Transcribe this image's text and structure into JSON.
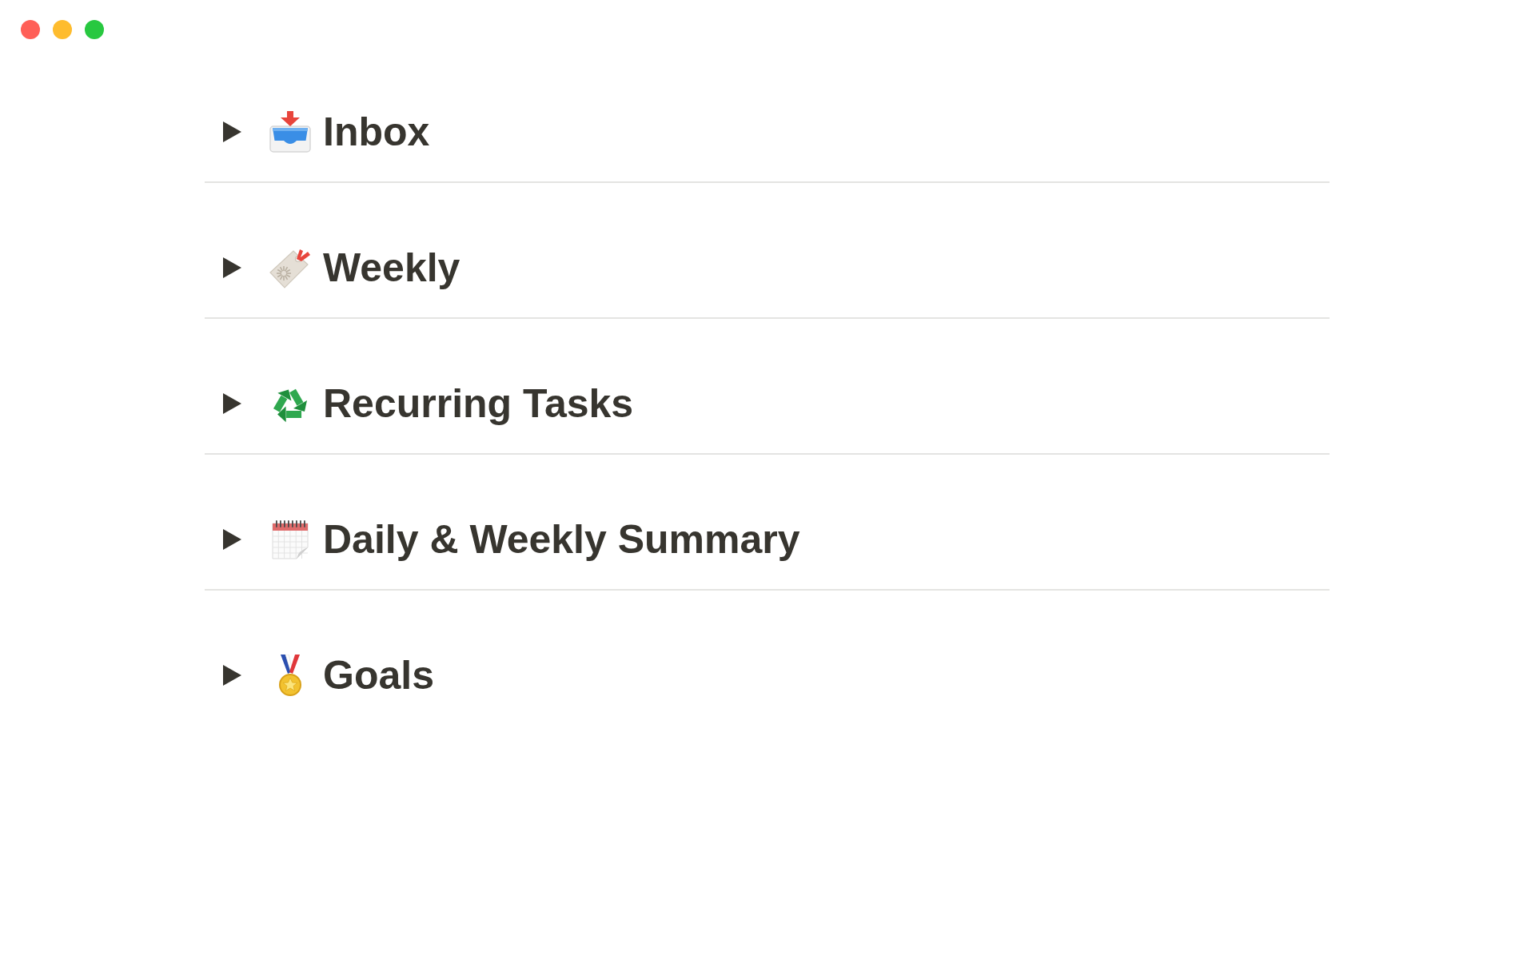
{
  "window": {
    "controls": [
      {
        "kind": "close"
      },
      {
        "kind": "minimize"
      },
      {
        "kind": "zoom"
      }
    ]
  },
  "toggles": [
    {
      "kind": "inbox",
      "title": "Inbox",
      "expanded": false
    },
    {
      "kind": "tag",
      "title": "Weekly",
      "expanded": false
    },
    {
      "kind": "recycle",
      "title": "Recurring Tasks",
      "expanded": false
    },
    {
      "kind": "calendar",
      "title": "Daily & Weekly Summary",
      "expanded": false
    },
    {
      "kind": "medal",
      "title": "Goals",
      "expanded": false
    }
  ]
}
